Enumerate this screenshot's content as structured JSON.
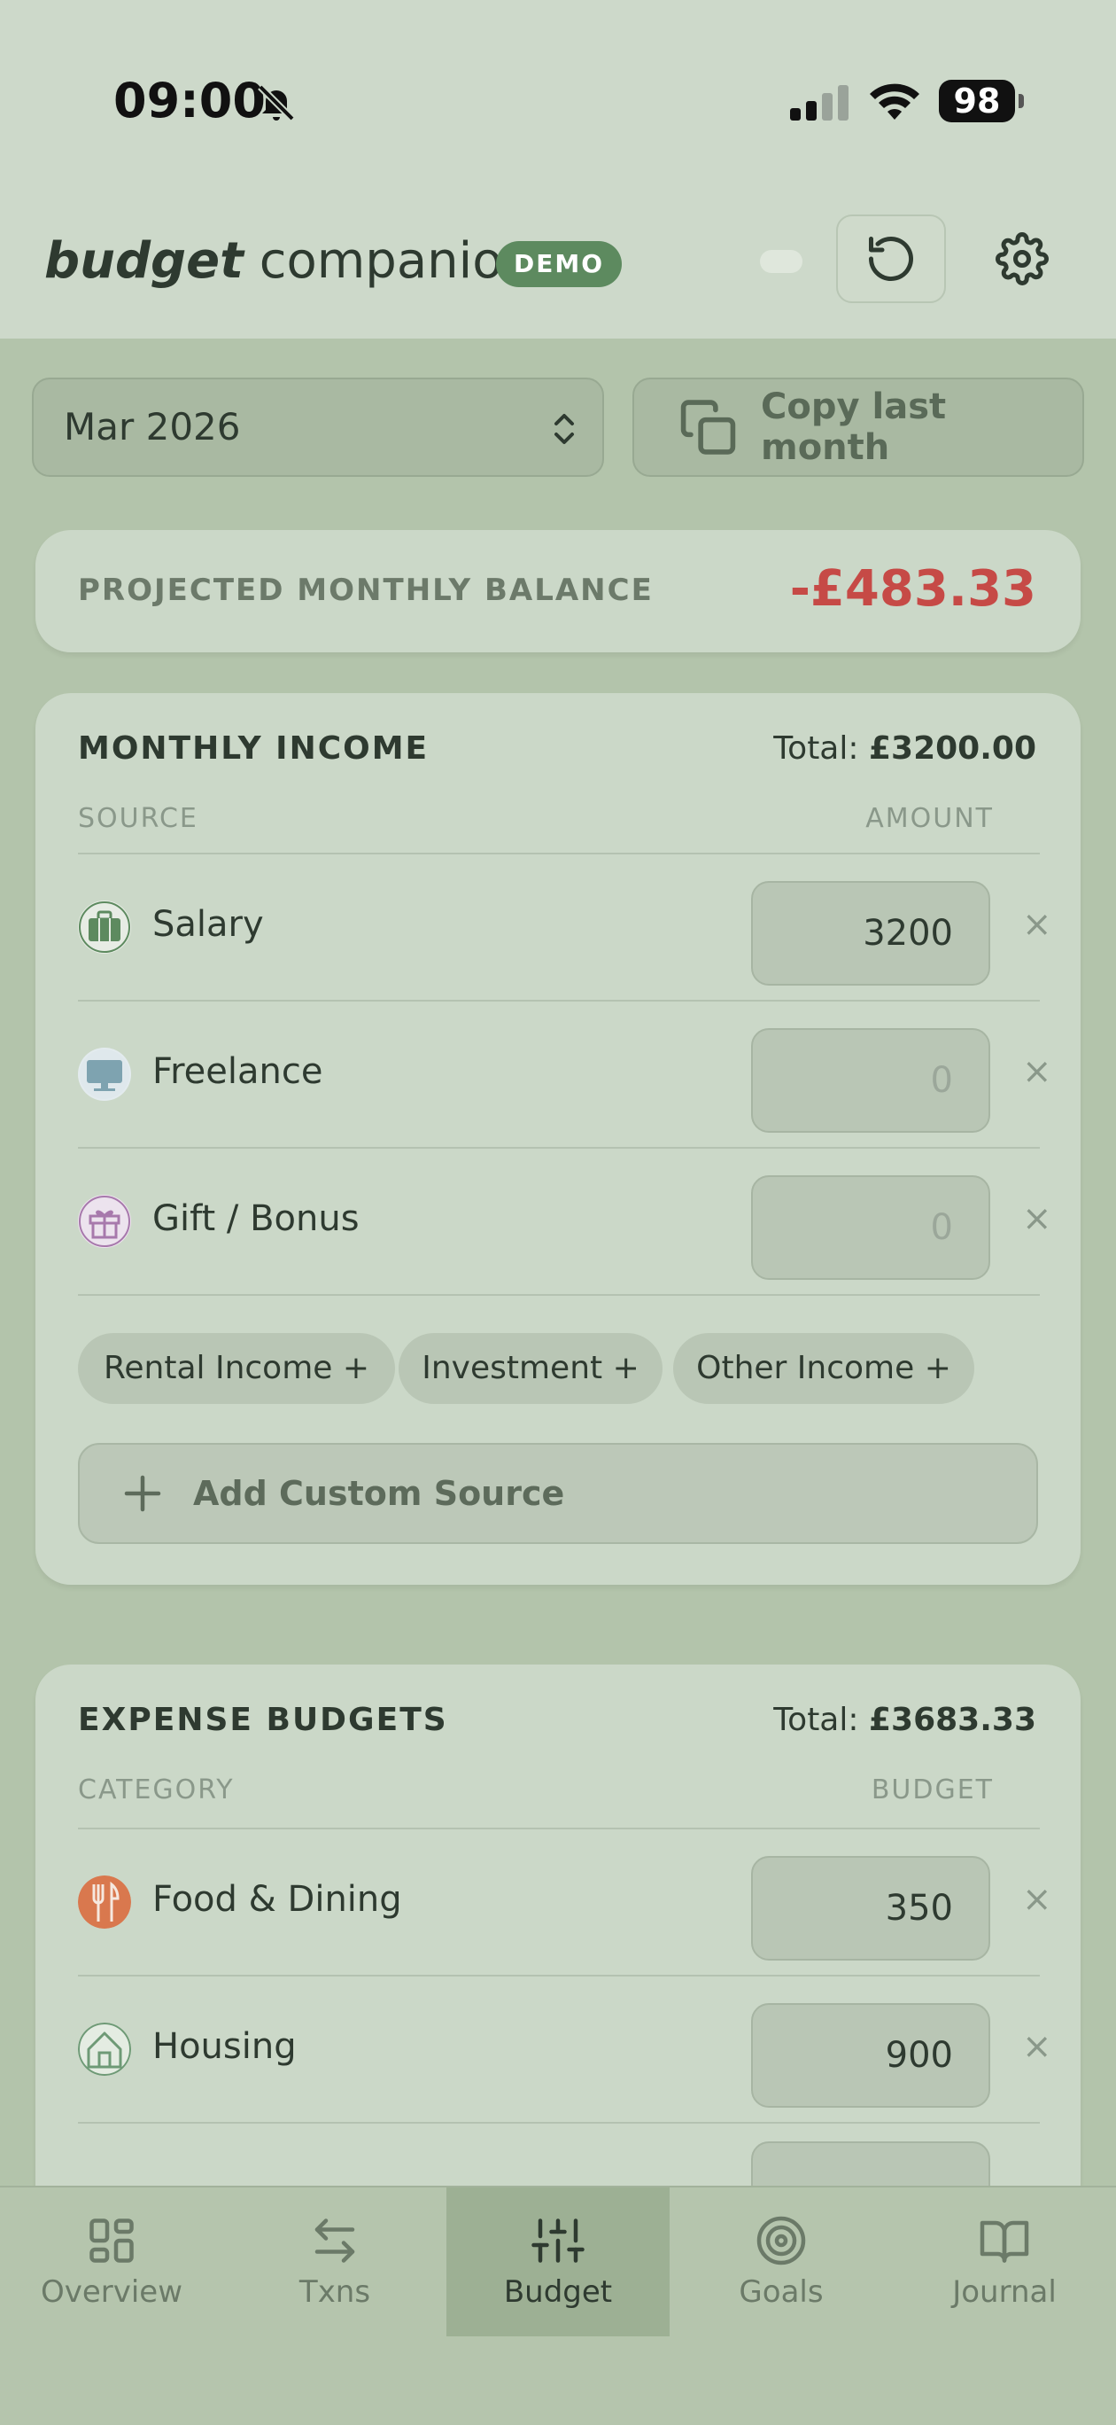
{
  "status": {
    "time": "09:00",
    "battery": "98"
  },
  "header": {
    "brand_bold": "budget",
    "brand_rest": "companion",
    "badge": "DEMO"
  },
  "month": {
    "selected": "Mar 2026",
    "copy_label": "Copy last month"
  },
  "balance": {
    "label": "PROJECTED MONTHLY BALANCE",
    "value": "-£483.33"
  },
  "income": {
    "title": "MONTHLY INCOME",
    "total_prefix": "Total:",
    "total": "£3200.00",
    "col_source": "SOURCE",
    "col_amount": "AMOUNT",
    "rows": [
      {
        "label": "Salary",
        "value": "3200",
        "icon": "briefcase-icon"
      },
      {
        "label": "Freelance",
        "value": "0",
        "icon": "monitor-icon"
      },
      {
        "label": "Gift / Bonus",
        "value": "0",
        "icon": "gift-icon"
      }
    ],
    "chips": [
      "Rental Income +",
      "Investment +",
      "Other Income +"
    ],
    "add_custom": "Add Custom Source"
  },
  "expenses": {
    "title": "EXPENSE BUDGETS",
    "total_prefix": "Total:",
    "total": "£3683.33",
    "col_category": "CATEGORY",
    "col_budget": "BUDGET",
    "rows": [
      {
        "label": "Food & Dining",
        "value": "350",
        "icon": "utensils-icon"
      },
      {
        "label": "Housing",
        "value": "900",
        "icon": "house-icon"
      }
    ]
  },
  "nav": [
    {
      "label": "Overview",
      "icon": "grid-icon"
    },
    {
      "label": "Txns",
      "icon": "arrows-icon"
    },
    {
      "label": "Budget",
      "icon": "sliders-icon",
      "active": true
    },
    {
      "label": "Goals",
      "icon": "target-icon"
    },
    {
      "label": "Journal",
      "icon": "book-icon"
    }
  ],
  "colors": {
    "accent": "#5d8a5f",
    "negative": "#c64a46",
    "background": "#b3c4ab"
  }
}
